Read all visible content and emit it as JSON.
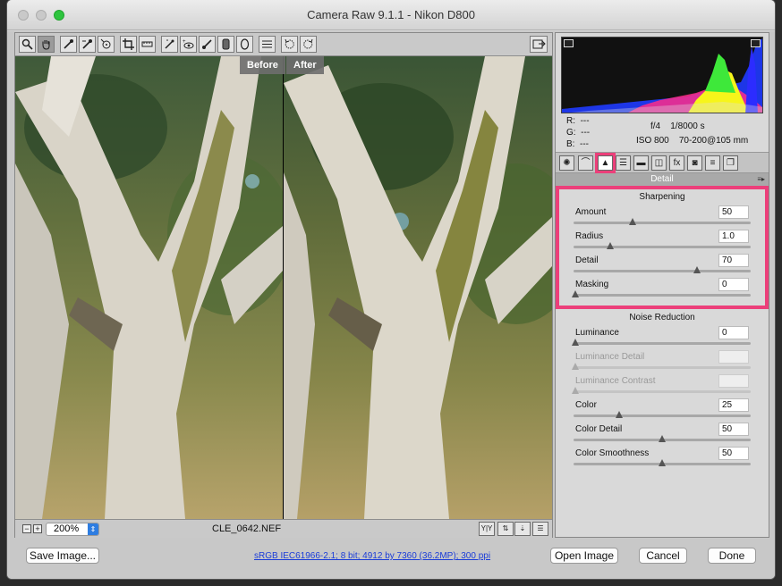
{
  "window": {
    "title": "Camera Raw 9.1.1  -  Nikon D800"
  },
  "preview": {
    "before_label": "Before",
    "after_label": "After",
    "zoom": "200%",
    "filename": "CLE_0642.NEF"
  },
  "info": {
    "r_label": "R:",
    "r_value": "---",
    "g_label": "G:",
    "g_value": "---",
    "b_label": "B:",
    "b_value": "---",
    "aperture": "f/4",
    "shutter": "1/8000 s",
    "iso": "ISO 800",
    "lens": "70-200@105 mm"
  },
  "panel": {
    "title": "Detail",
    "sharpening": {
      "heading": "Sharpening",
      "controls": [
        {
          "label": "Amount",
          "value": "50",
          "fraction": 0.33
        },
        {
          "label": "Radius",
          "value": "1.0",
          "fraction": 0.2
        },
        {
          "label": "Detail",
          "value": "70",
          "fraction": 0.7
        },
        {
          "label": "Masking",
          "value": "0",
          "fraction": 0.0
        }
      ]
    },
    "noise": {
      "heading": "Noise Reduction",
      "controls": [
        {
          "label": "Luminance",
          "value": "0",
          "fraction": 0.0,
          "enabled": true
        },
        {
          "label": "Luminance Detail",
          "value": "",
          "fraction": 0.0,
          "enabled": false
        },
        {
          "label": "Luminance Contrast",
          "value": "",
          "fraction": 0.0,
          "enabled": false
        },
        {
          "label": "Color",
          "value": "25",
          "fraction": 0.25,
          "enabled": true
        },
        {
          "label": "Color Detail",
          "value": "50",
          "fraction": 0.5,
          "enabled": true
        },
        {
          "label": "Color Smoothness",
          "value": "50",
          "fraction": 0.5,
          "enabled": true
        }
      ]
    }
  },
  "footer": {
    "save_label": "Save Image...",
    "workflow": "sRGB IEC61966-2.1; 8 bit; 4912 by 7360 (36.2MP); 300 ppi",
    "open_label": "Open Image",
    "cancel_label": "Cancel",
    "done_label": "Done"
  },
  "colors": {
    "highlight": "#ec3f7a",
    "accent": "#2e7de1"
  }
}
